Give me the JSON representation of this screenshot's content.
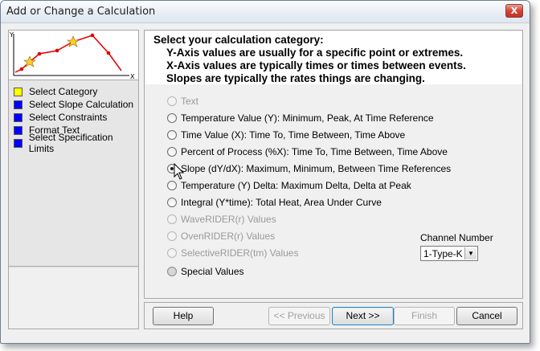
{
  "window": {
    "title": "Add or Change a Calculation",
    "close_label": "X"
  },
  "preview": {
    "y_label": "Y",
    "x_label": "X"
  },
  "steps": [
    {
      "label": "Select Category",
      "color": "#ffff00"
    },
    {
      "label": "Select Slope Calculation",
      "color": "#0000ff"
    },
    {
      "label": "Select Constraints",
      "color": "#0000ff"
    },
    {
      "label": "Format Text",
      "color": "#0000ff"
    },
    {
      "label": "Select Specification Limits",
      "color": "#0000ff"
    }
  ],
  "header": {
    "line1": "Select your calculation category:",
    "line2": "Y-Axis values are usually for a specific point or extremes.",
    "line3": "X-Axis values are typically times or times between events.",
    "line4": "Slopes are typically the rates things are changing."
  },
  "options": [
    {
      "label": "Text",
      "enabled": false,
      "checked": false
    },
    {
      "label": "Temperature Value (Y):  Minimum, Peak, At Time Reference",
      "enabled": true,
      "checked": false
    },
    {
      "label": "Time Value (X):  Time To, Time Between, Time Above",
      "enabled": true,
      "checked": false
    },
    {
      "label": "Percent of Process (%X):  Time To, Time Between, Time Above",
      "enabled": true,
      "checked": false
    },
    {
      "label": "Slope (dY/dX):  Maximum, Minimum, Between Time References",
      "enabled": true,
      "checked": true
    },
    {
      "label": "Temperature (Y) Delta:  Maximum Delta, Delta at Peak",
      "enabled": true,
      "checked": false
    },
    {
      "label": "Integral (Y*time): Total Heat, Area Under Curve",
      "enabled": true,
      "checked": false
    },
    {
      "label": "WaveRIDER(r) Values",
      "enabled": false,
      "checked": false
    },
    {
      "label": "OvenRIDER(r) Values",
      "enabled": false,
      "checked": false
    },
    {
      "label": "SelectiveRIDER(tm) Values",
      "enabled": false,
      "checked": false
    },
    {
      "label": "Special  Values",
      "enabled": true,
      "checked": false
    }
  ],
  "channel": {
    "label": "Channel Number",
    "value": "1-Type-K"
  },
  "buttons": {
    "help": "Help",
    "previous": "<< Previous",
    "next": "Next >>",
    "finish": "Finish",
    "cancel": "Cancel"
  }
}
